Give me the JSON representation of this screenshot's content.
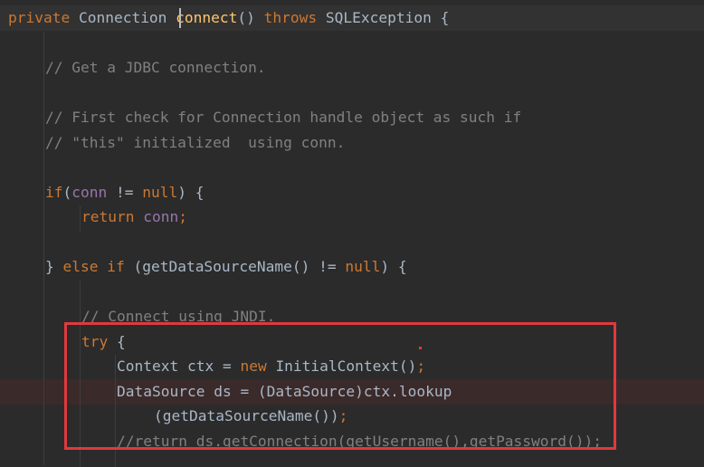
{
  "editor": {
    "lines": [
      {
        "id": "sig",
        "tokens": [
          {
            "t": "private ",
            "c": "kw"
          },
          {
            "t": "Connection ",
            "c": "cls"
          },
          {
            "t": "connect",
            "c": "fn"
          },
          {
            "t": "() ",
            "c": "cls"
          },
          {
            "t": "throws ",
            "c": "kw"
          },
          {
            "t": "SQLException {",
            "c": "cls"
          }
        ]
      },
      {
        "id": "c1",
        "tokens": [
          {
            "t": "// Get a JDBC connection.",
            "c": "cm"
          }
        ]
      },
      {
        "id": "c2",
        "tokens": [
          {
            "t": "// First check for Connection handle object as such if",
            "c": "cm"
          }
        ]
      },
      {
        "id": "c3",
        "tokens": [
          {
            "t": "// \"this\" initialized  using conn.",
            "c": "cm"
          }
        ]
      },
      {
        "id": "if",
        "tokens": [
          {
            "t": "if",
            "c": "kw"
          },
          {
            "t": "(",
            "c": "cls"
          },
          {
            "t": "conn",
            "c": "fld"
          },
          {
            "t": " != ",
            "c": "cls"
          },
          {
            "t": "null",
            "c": "kw"
          },
          {
            "t": ") {",
            "c": "cls"
          }
        ]
      },
      {
        "id": "ret",
        "tokens": [
          {
            "t": "return ",
            "c": "kw"
          },
          {
            "t": "conn",
            "c": "fld"
          },
          {
            "t": ";",
            "c": "kw"
          }
        ]
      },
      {
        "id": "else",
        "tokens": [
          {
            "t": "} ",
            "c": "cls"
          },
          {
            "t": "else if ",
            "c": "kw"
          },
          {
            "t": "(getDataSourceName() != ",
            "c": "cls"
          },
          {
            "t": "null",
            "c": "kw"
          },
          {
            "t": ") {",
            "c": "cls"
          }
        ]
      },
      {
        "id": "c4",
        "tokens": [
          {
            "t": "// Connect using JNDI.",
            "c": "cm"
          }
        ]
      },
      {
        "id": "try",
        "tokens": [
          {
            "t": "try ",
            "c": "kw"
          },
          {
            "t": "{",
            "c": "cls"
          }
        ]
      },
      {
        "id": "ctx",
        "tokens": [
          {
            "t": "Context ctx = ",
            "c": "cls"
          },
          {
            "t": "new ",
            "c": "kw"
          },
          {
            "t": "InitialContext()",
            "c": "cls"
          },
          {
            "t": ";",
            "c": "kw"
          }
        ]
      },
      {
        "id": "ds",
        "tokens": [
          {
            "t": "DataSource ds = (DataSource)ctx.lookup",
            "c": "cls"
          }
        ]
      },
      {
        "id": "arg",
        "tokens": [
          {
            "t": "(getDataSourceName())",
            "c": "cls"
          },
          {
            "t": ";",
            "c": "kw"
          }
        ]
      },
      {
        "id": "c5",
        "tokens": [
          {
            "t": "//return ds.getConnection(getUsername(),getPassword());",
            "c": "cm"
          }
        ]
      }
    ]
  }
}
